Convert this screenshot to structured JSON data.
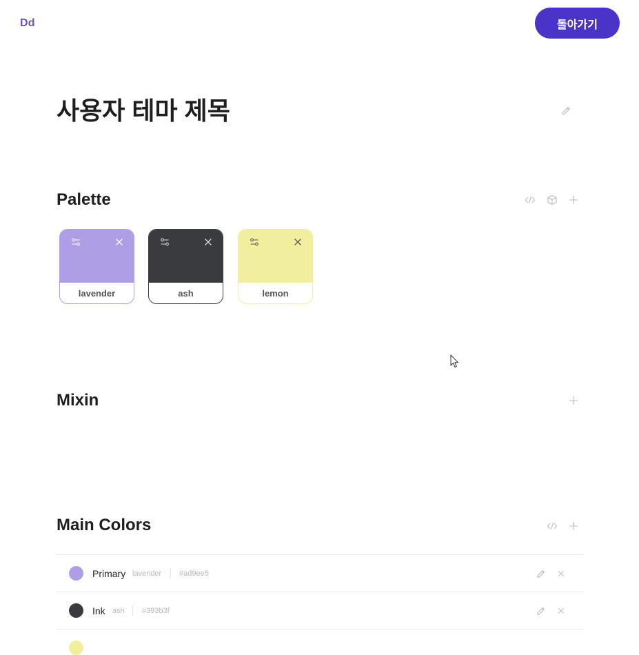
{
  "header": {
    "logo": "Dd",
    "back_button_label": "돌아가기"
  },
  "theme": {
    "title": "사용자 테마 제목"
  },
  "colors": {
    "accent": "#4a34c8",
    "logo": "#6a4fd3"
  },
  "palette": {
    "heading": "Palette",
    "actions": [
      "code-icon",
      "package-icon",
      "plus-icon"
    ],
    "swatches": [
      {
        "name": "lavender",
        "hex": "#ad9ee5",
        "border": "#ad9ee5"
      },
      {
        "name": "ash",
        "hex": "#393b3f",
        "border": "#393b3f"
      },
      {
        "name": "lemon",
        "hex": "#f1ef9d",
        "border": "#f1ef9d"
      }
    ]
  },
  "mixin": {
    "heading": "Mixin",
    "actions": [
      "plus-icon"
    ]
  },
  "main_colors": {
    "heading": "Main Colors",
    "actions": [
      "code-icon",
      "plus-icon"
    ],
    "rows": [
      {
        "name": "Primary",
        "palette_ref": "lavender",
        "hex": "#ad9ee5"
      },
      {
        "name": "Ink",
        "palette_ref": "ash",
        "hex": "#393b3f"
      }
    ],
    "partial_row_color": "#f1ef9d"
  }
}
